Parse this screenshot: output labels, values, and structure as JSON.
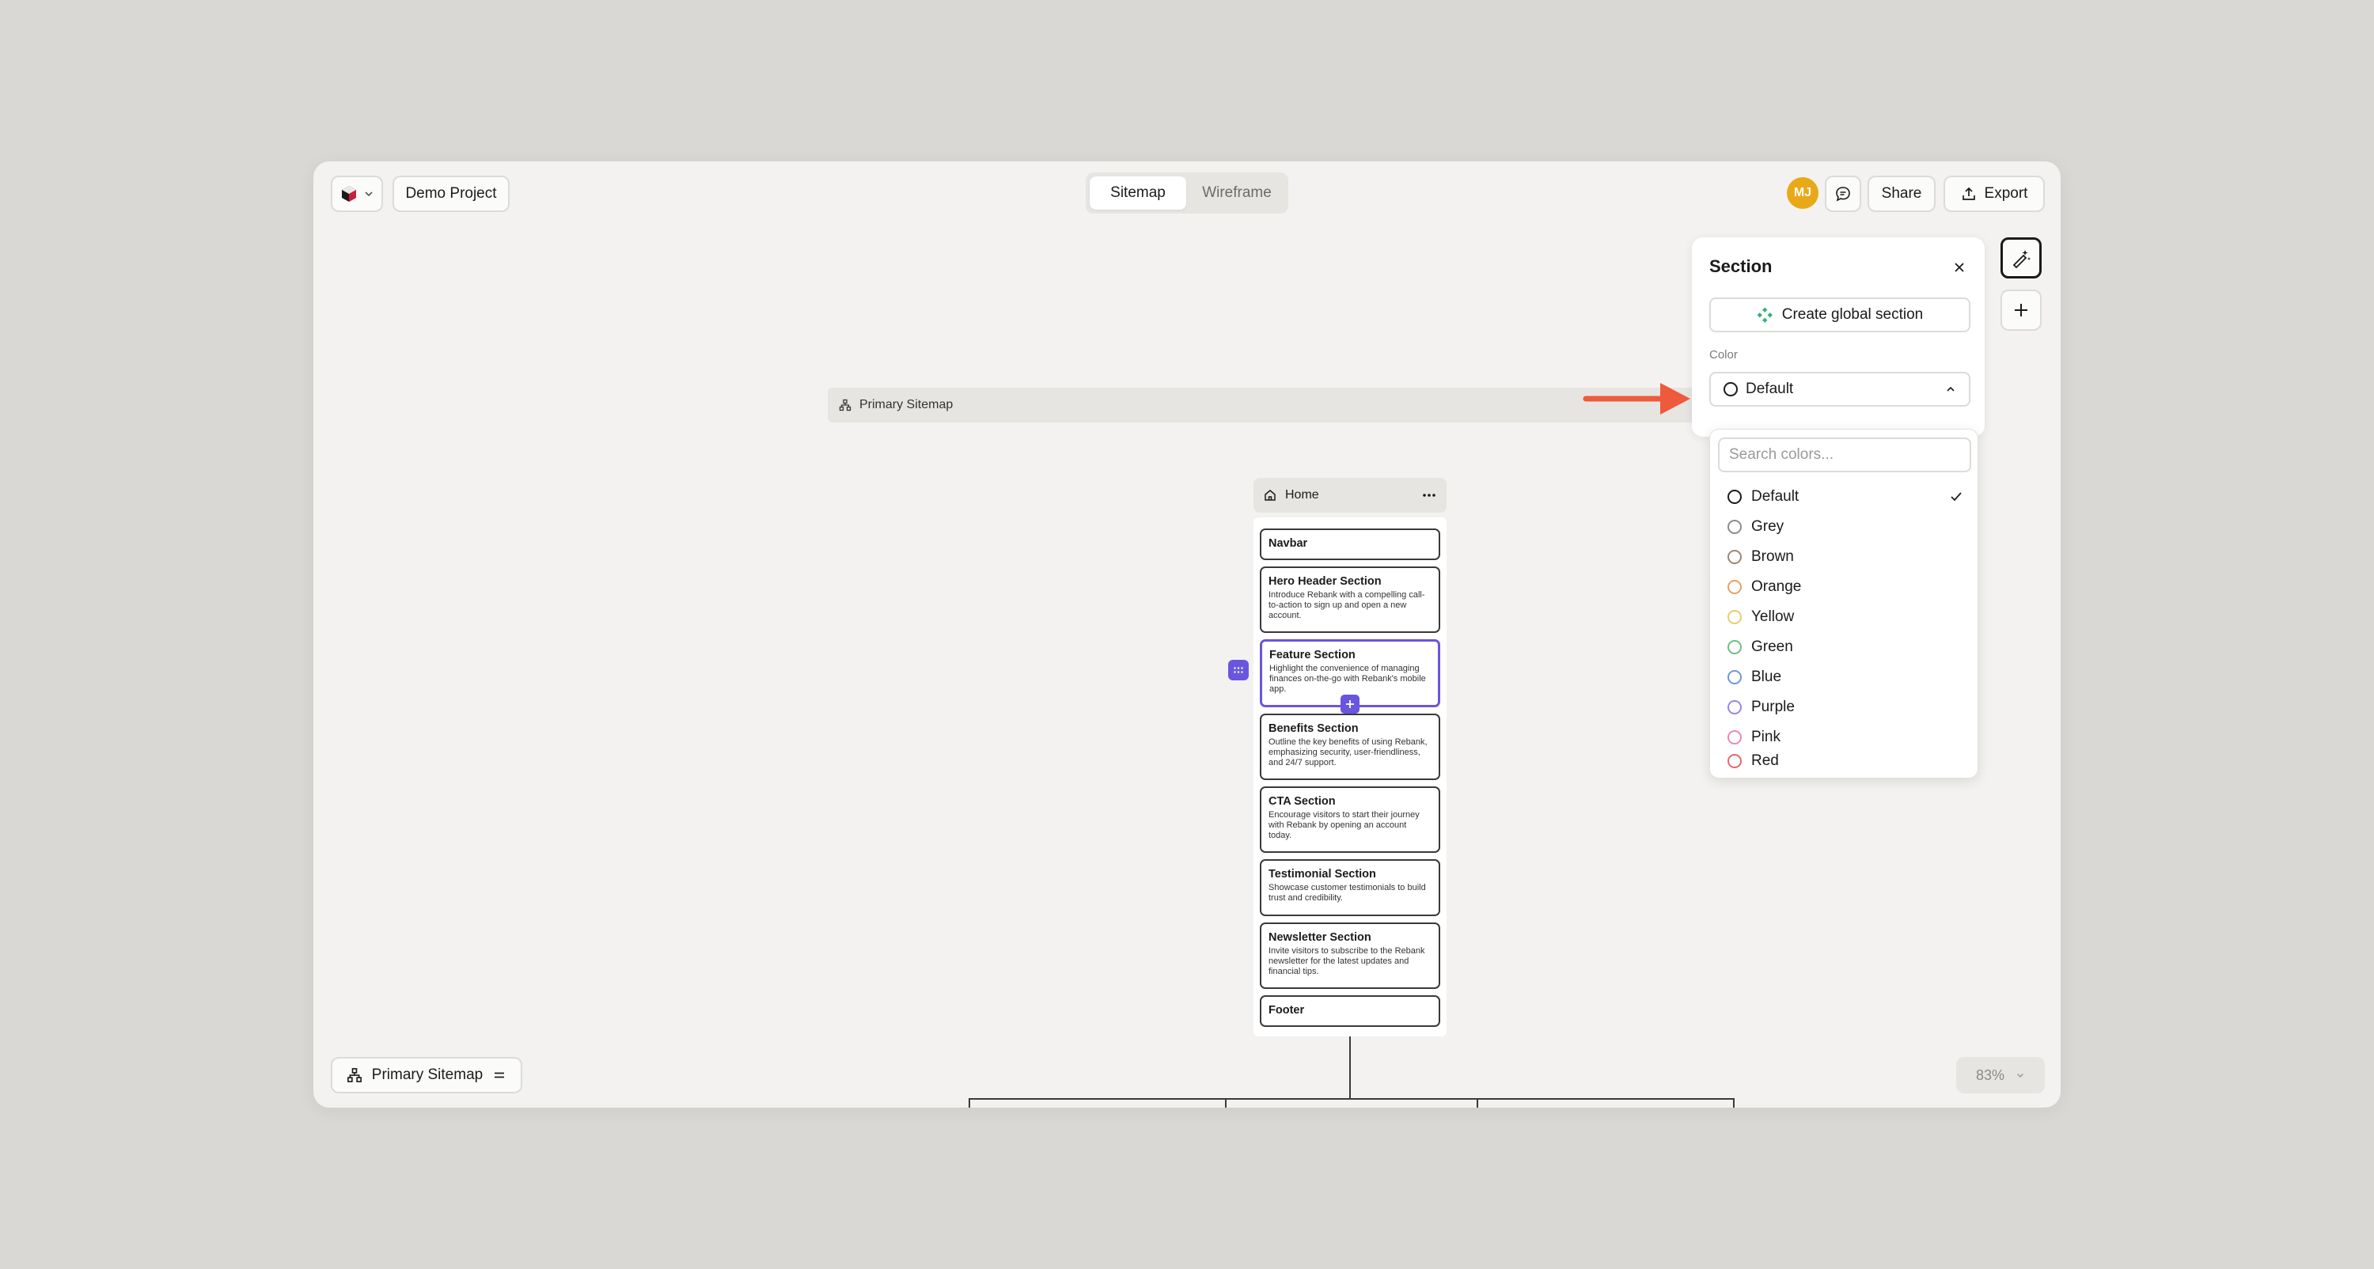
{
  "topbar": {
    "project_name": "Demo Project",
    "tabs": [
      {
        "label": "Sitemap",
        "active": true
      },
      {
        "label": "Wireframe",
        "active": false
      }
    ],
    "avatar_initials": "MJ",
    "share_label": "Share",
    "export_label": "Export"
  },
  "canvas": {
    "sitemap_bar_label": "Primary Sitemap",
    "home": {
      "title": "Home",
      "sections": [
        {
          "title": "Navbar",
          "desc": ""
        },
        {
          "title": "Hero Header Section",
          "desc": "Introduce Rebank with a compelling call-to-action to sign up and open a new account."
        },
        {
          "title": "Feature Section",
          "desc": "Highlight the convenience of managing finances on-the-go with Rebank's mobile app.",
          "selected": true
        },
        {
          "title": "Benefits Section",
          "desc": "Outline the key benefits of using Rebank, emphasizing security, user-friendliness, and 24/7 support."
        },
        {
          "title": "CTA Section",
          "desc": "Encourage visitors to start their journey with Rebank by opening an account today."
        },
        {
          "title": "Testimonial Section",
          "desc": "Showcase customer testimonials to build trust and credibility."
        },
        {
          "title": "Newsletter Section",
          "desc": "Invite visitors to subscribe to the Rebank newsletter for the latest updates and financial tips."
        },
        {
          "title": "Footer",
          "desc": ""
        }
      ]
    }
  },
  "bottom": {
    "sitemap_selector_label": "Primary Sitemap",
    "zoom": "83%"
  },
  "panel": {
    "title": "Section",
    "global_button_label": "Create global section",
    "color_label": "Color",
    "selected_color": "Default",
    "search_placeholder": "Search colors...",
    "options": [
      {
        "label": "Default",
        "color": "#1b1b1b",
        "checked": true
      },
      {
        "label": "Grey",
        "color": "#8c8c8c"
      },
      {
        "label": "Brown",
        "color": "#a08574"
      },
      {
        "label": "Orange",
        "color": "#e8a06a"
      },
      {
        "label": "Yellow",
        "color": "#e6cf6a"
      },
      {
        "label": "Green",
        "color": "#6cbf84"
      },
      {
        "label": "Blue",
        "color": "#6f95e3"
      },
      {
        "label": "Purple",
        "color": "#9b86e3"
      },
      {
        "label": "Pink",
        "color": "#e98bb3"
      },
      {
        "label": "Red",
        "color": "#e06b6b"
      }
    ]
  },
  "colors": {
    "accent": "#6a55e0",
    "annotation_arrow": "#ee5a3c",
    "global_icon": "#2bb673",
    "avatar": "#e9a817"
  }
}
